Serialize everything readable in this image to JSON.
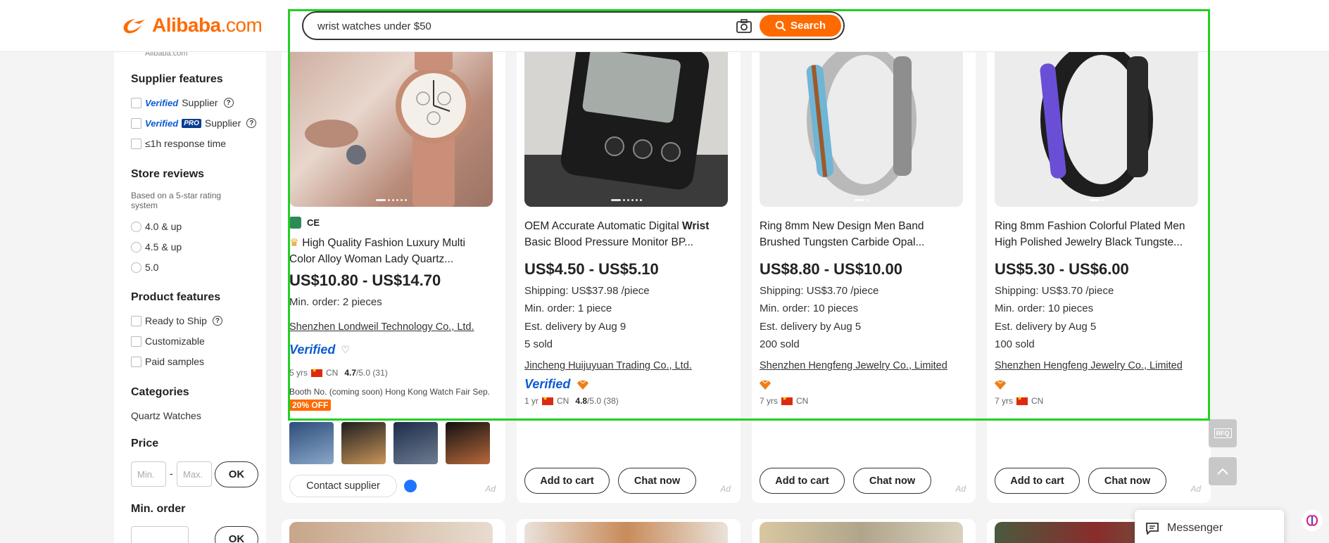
{
  "header": {
    "logo_text": "Alibaba",
    "logo_suffix": ".com",
    "search_value": "wrist watches under $50",
    "search_button": "Search",
    "icons": {
      "camera": "camera-icon",
      "search": "search-icon"
    }
  },
  "sidebar": {
    "prev_text": "Alibaba.com",
    "supplier_features": {
      "heading": "Supplier features",
      "verified_badge": "Verified",
      "verified_label": "Supplier",
      "verified_pro_badge_1": "Verified",
      "verified_pro_badge_2": "PRO",
      "verified_pro_label": "Supplier",
      "response_time": "≤1h response time"
    },
    "store_reviews": {
      "heading": "Store reviews",
      "note": "Based on a 5-star rating system",
      "options": [
        "4.0 & up",
        "4.5 & up",
        "5.0"
      ]
    },
    "product_features": {
      "heading": "Product features",
      "options": [
        "Ready to Ship",
        "Customizable",
        "Paid samples"
      ]
    },
    "categories": {
      "heading": "Categories",
      "item": "Quartz Watches"
    },
    "price": {
      "heading": "Price",
      "min_placeholder": "Min.",
      "separator": "-",
      "max_placeholder": "Max.",
      "ok": "OK"
    },
    "min_order": {
      "heading": "Min. order",
      "ok": "OK"
    }
  },
  "cards": [
    {
      "title_prefix": "",
      "title": "High Quality Fashion Luxury Multi Color Alloy Woman Lady Quartz...",
      "price": "US$10.80 - US$14.70",
      "min_order": "Min. order: 2 pieces",
      "supplier": "Shenzhen Londweil Technology Co., Ltd.",
      "verified": "Verified",
      "years": "5 yrs",
      "country": "CN",
      "rating": "4.7",
      "rating_suffix": "/5.0 (31)",
      "booth": "Booth No. (coming soon) Hong Kong Watch Fair Sep.",
      "discount": "20% OFF",
      "cert": "CE",
      "contact": "Contact supplier",
      "ad": "Ad"
    },
    {
      "title_a": "OEM Accurate Automatic Digital ",
      "title_bold": "Wrist",
      "title_b": " Basic Blood Pressure Monitor BP...",
      "price": "US$4.50 - US$5.10",
      "shipping": "Shipping: US$37.98 /piece",
      "min_order": "Min. order: 1 piece",
      "delivery": "Est. delivery by Aug 9",
      "sold": "5 sold",
      "supplier": "Jincheng Huijuyuan Trading Co., Ltd.",
      "verified": "Verified",
      "years": "1 yr",
      "country": "CN",
      "rating": "4.8",
      "rating_suffix": "/5.0 (38)",
      "add_to_cart": "Add to cart",
      "chat_now": "Chat now",
      "ad": "Ad"
    },
    {
      "title": "Ring 8mm New Design Men Band Brushed Tungsten Carbide Opal...",
      "price": "US$8.80 - US$10.00",
      "shipping": "Shipping: US$3.70 /piece",
      "min_order": "Min. order: 10 pieces",
      "delivery": "Est. delivery by Aug 5",
      "sold": "200 sold",
      "supplier": "Shenzhen Hengfeng Jewelry Co., Limited",
      "years": "7 yrs",
      "country": "CN",
      "add_to_cart": "Add to cart",
      "chat_now": "Chat now",
      "ad": "Ad"
    },
    {
      "title": "Ring 8mm Fashion Colorful Plated Men High Polished Jewelry Black Tungste...",
      "price": "US$5.30 - US$6.00",
      "shipping": "Shipping: US$3.70 /piece",
      "min_order": "Min. order: 10 pieces",
      "delivery": "Est. delivery by Aug 5",
      "sold": "100 sold",
      "supplier": "Shenzhen Hengfeng Jewelry Co., Limited",
      "years": "7 yrs",
      "country": "CN",
      "add_to_cart": "Add to cart",
      "chat_now": "Chat now",
      "ad": "Ad"
    }
  ],
  "floating": {
    "rfq": "RFQ",
    "messenger": "Messenger"
  },
  "colors": {
    "brand": "#ff6a00",
    "highlight": "#22d022",
    "verified": "#0b5bd3"
  }
}
